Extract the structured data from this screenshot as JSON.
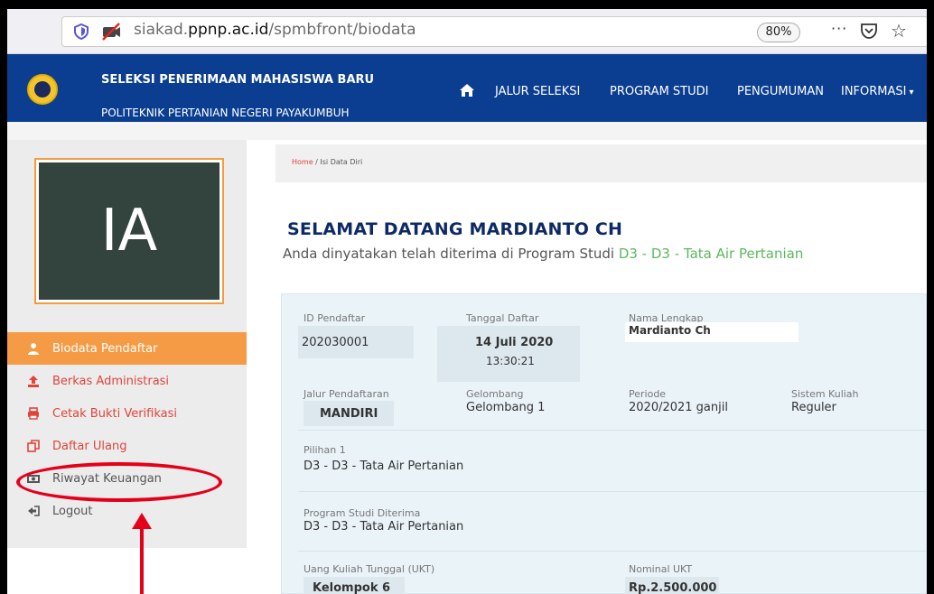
{
  "browser": {
    "url_prefix": "siakad.",
    "url_domain": "ppnp.ac.id",
    "url_path": "/spmbfront/biodata",
    "zoom": "80%",
    "menu_dots": "···"
  },
  "header": {
    "title": "SELEKSI PENERIMAAN MAHASISWA BARU",
    "subtitle": "POLITEKNIK PERTANIAN NEGERI PAYAKUMBUH",
    "nav": [
      "JALUR SELEKSI",
      "PROGRAM STUDI",
      "PENGUMUMAN",
      "INFORMASI"
    ]
  },
  "sidebar": {
    "avatar_initials": "IA",
    "items": [
      {
        "label": "Biodata Pendaftar",
        "icon": "user-icon"
      },
      {
        "label": "Berkas Administrasi",
        "icon": "upload-icon"
      },
      {
        "label": "Cetak Bukti Verifikasi",
        "icon": "printer-icon"
      },
      {
        "label": "Daftar Ulang",
        "icon": "copy-icon"
      },
      {
        "label": "Riwayat Keuangan",
        "icon": "money-icon"
      },
      {
        "label": "Logout",
        "icon": "logout-icon"
      }
    ]
  },
  "breadcrumb": {
    "home": "Home",
    "sep": " / ",
    "current": "Isi Data Diri"
  },
  "welcome": {
    "heading": "SELAMAT DATANG MARDIANTO CH",
    "accepted_text": "Anda dinyatakan telah diterima di Program Studi ",
    "accepted_program": "D3 - D3 - Tata Air Pertanian"
  },
  "biodata": {
    "id_label": "ID Pendaftar",
    "id_value": "202030001",
    "date_label": "Tanggal Daftar",
    "date_value": "14 Juli 2020",
    "time_value": "13:30:21",
    "name_label": "Nama Lengkap",
    "name_value": "Mardianto Ch",
    "jalur_label": "Jalur Pendaftaran",
    "jalur_value": "MANDIRI",
    "gel_label": "Gelombang",
    "gel_value": "Gelombang 1",
    "periode_label": "Periode",
    "periode_value": "2020/2021 ganjil",
    "sistem_label": "Sistem Kuliah",
    "sistem_value": "Reguler",
    "pilihan_label": "Pilihan 1",
    "pilihan_value": "D3 - D3 - Tata Air Pertanian",
    "prodi_label": "Program Studi Diterima",
    "prodi_value": "D3 - D3 - Tata Air Pertanian",
    "ukt_label": "Uang Kuliah Tunggal (UKT)",
    "ukt_value": "Kelompok 6",
    "nominal_label": "Nominal UKT",
    "nominal_value": "Rp.2.500.000"
  },
  "colors": {
    "header": "#0b3e91",
    "active": "#f59b45",
    "link": "#e0443a",
    "accent": "#5cb85c",
    "annotation": "#e5001a"
  }
}
